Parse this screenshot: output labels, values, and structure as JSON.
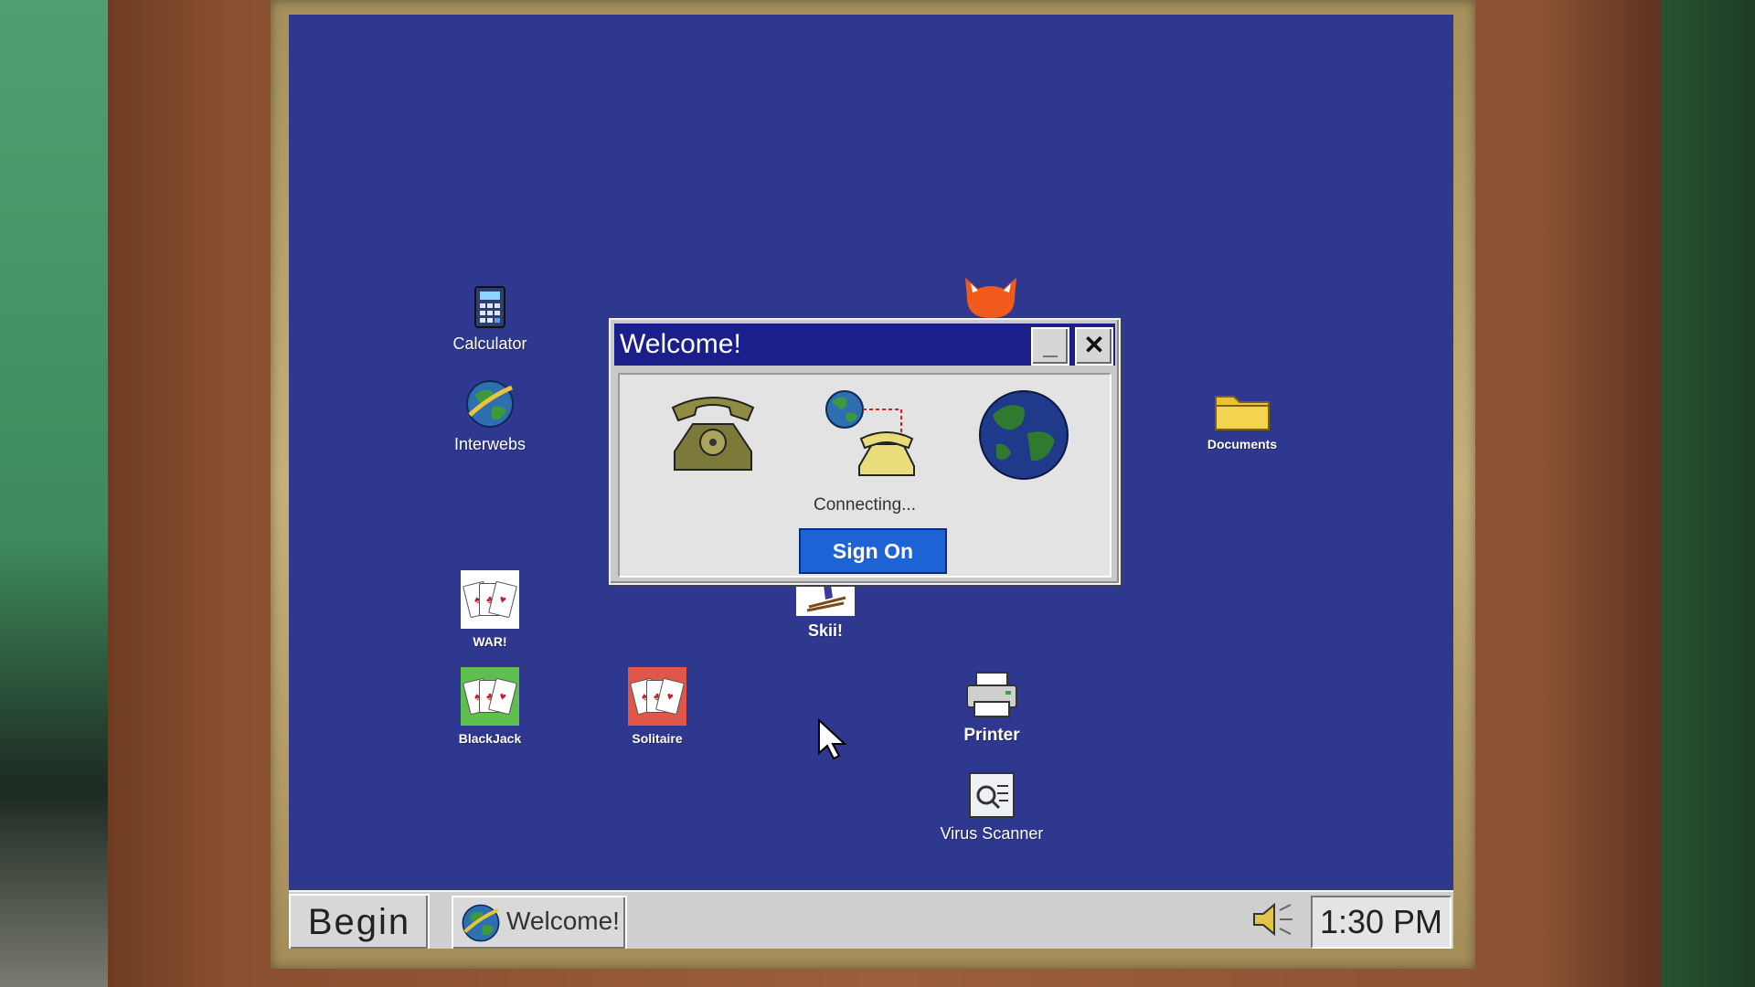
{
  "desktop": {
    "background": "#2f388f",
    "icons": [
      {
        "label": "Calculator"
      },
      {
        "label": "Interwebs"
      },
      {
        "label": "Documents"
      },
      {
        "label": "WAR!"
      },
      {
        "label": "Skii!"
      },
      {
        "label": "BlackJack"
      },
      {
        "label": "Solitaire"
      },
      {
        "label": "Printer"
      },
      {
        "label": "Virus Scanner"
      }
    ]
  },
  "window": {
    "title": "Welcome!",
    "minimize_label": "_",
    "close_label": "✕",
    "status": "Connecting...",
    "signon_label": "Sign On"
  },
  "taskbar": {
    "begin_label": "Begin",
    "task_label": "Welcome!",
    "clock": "1:30 PM"
  }
}
